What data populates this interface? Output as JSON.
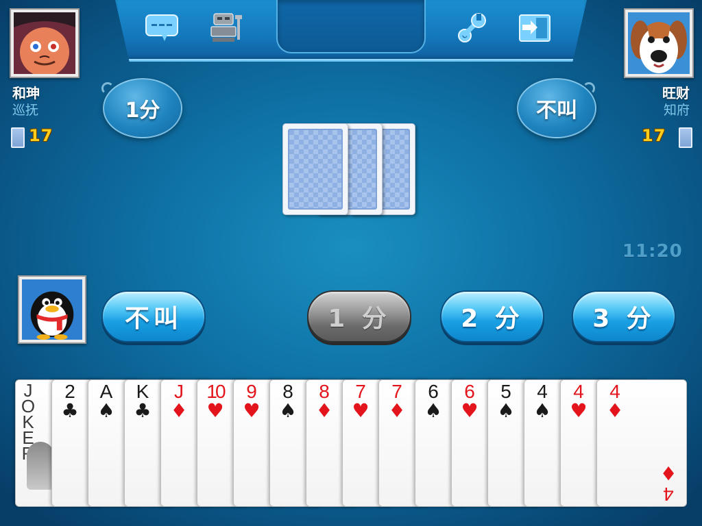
{
  "toolbar": {
    "icons": [
      "chat-icon",
      "robot-icon",
      "settings-wrench-icon",
      "exit-icon"
    ]
  },
  "left_player": {
    "name": "和珅",
    "title": "巡抚",
    "cards_left": "17",
    "bid": "1分"
  },
  "right_player": {
    "name": "旺财",
    "title": "知府",
    "cards_left": "17",
    "bid": "不叫"
  },
  "timer": "11:20",
  "actions": {
    "pass": "不叫",
    "one": "1 分",
    "two": "2 分",
    "three": "3 分",
    "one_disabled": true
  },
  "hand": [
    {
      "rank": "JOKER",
      "suit": "",
      "color": "black"
    },
    {
      "rank": "2",
      "suit": "♣",
      "color": "black"
    },
    {
      "rank": "A",
      "suit": "♠",
      "color": "black"
    },
    {
      "rank": "K",
      "suit": "♣",
      "color": "black"
    },
    {
      "rank": "J",
      "suit": "♦",
      "color": "red"
    },
    {
      "rank": "10",
      "suit": "♥",
      "color": "red"
    },
    {
      "rank": "9",
      "suit": "♥",
      "color": "red"
    },
    {
      "rank": "8",
      "suit": "♠",
      "color": "black"
    },
    {
      "rank": "8",
      "suit": "♦",
      "color": "red"
    },
    {
      "rank": "7",
      "suit": "♥",
      "color": "red"
    },
    {
      "rank": "7",
      "suit": "♦",
      "color": "red"
    },
    {
      "rank": "6",
      "suit": "♠",
      "color": "black"
    },
    {
      "rank": "6",
      "suit": "♥",
      "color": "red"
    },
    {
      "rank": "5",
      "suit": "♠",
      "color": "black"
    },
    {
      "rank": "4",
      "suit": "♠",
      "color": "black"
    },
    {
      "rank": "4",
      "suit": "♥",
      "color": "red"
    },
    {
      "rank": "4",
      "suit": "♦",
      "color": "red"
    }
  ],
  "colors": {
    "table": "#0f72a6",
    "button_blue": "#1aa0e3",
    "button_grey": "#6b6b6b",
    "card_red": "#e3141b"
  }
}
